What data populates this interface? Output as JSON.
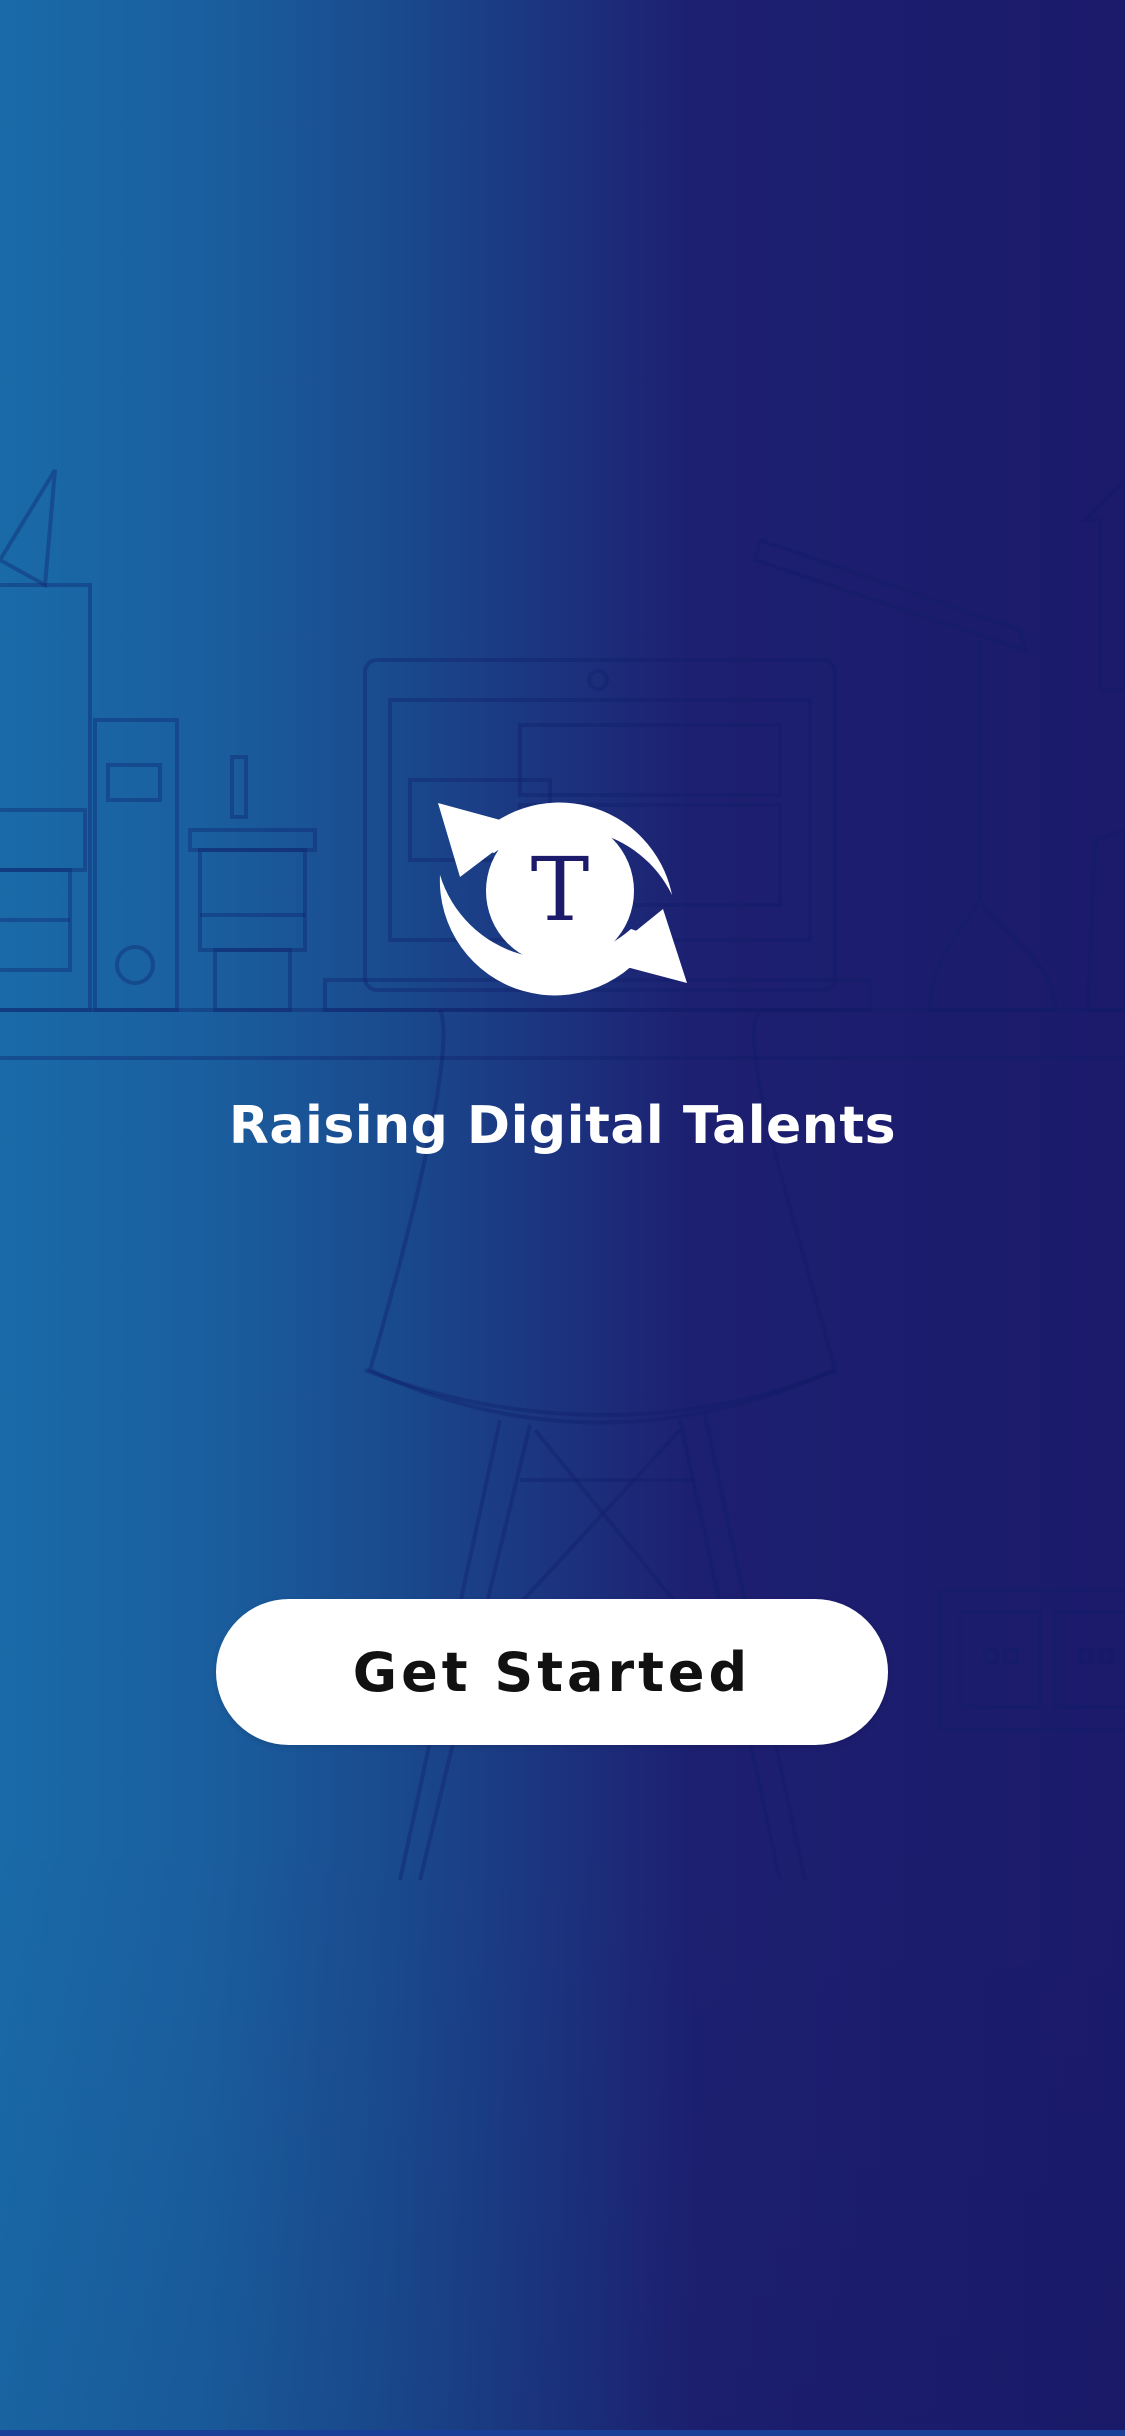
{
  "app": {
    "tagline": "Raising Digital Talents",
    "logo_letter": "T"
  },
  "actions": {
    "get_started_label": "Get Started"
  },
  "colors": {
    "gradient_left": "#1a6aa8",
    "gradient_right": "#1b1a6b",
    "button_background": "#ffffff",
    "button_text": "#111111",
    "logo_letter_color": "#1b1a6b"
  },
  "icons": {
    "logo": "refresh-cycle-T-icon"
  }
}
